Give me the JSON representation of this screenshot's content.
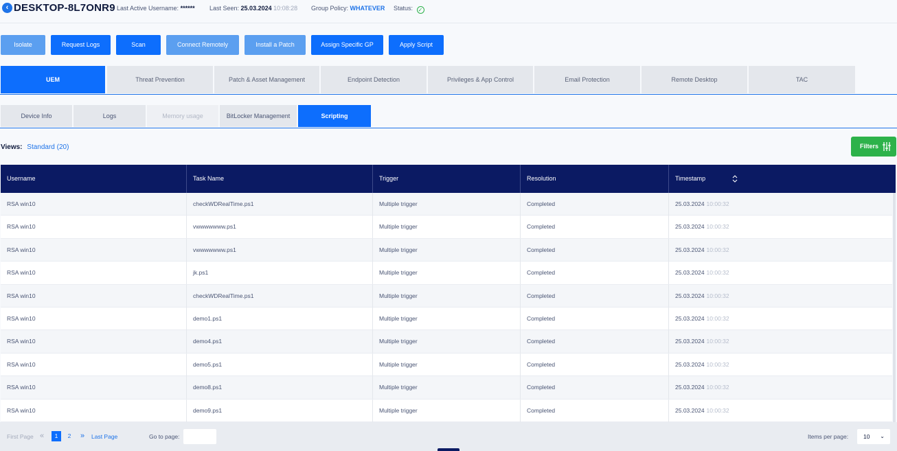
{
  "header": {
    "hostname": "DESKTOP-8L7ONR9",
    "last_active_label": "Last Active Username:",
    "last_active_value": "******",
    "last_seen_label": "Last Seen:",
    "last_seen_date": "25.03.2024",
    "last_seen_time": "10:08:28",
    "group_policy_label": "Group Policy:",
    "group_policy_value": "WHATEVER",
    "status_label": "Status:",
    "status_icon": "check-circle-icon"
  },
  "actions": [
    {
      "label": "Isolate"
    },
    {
      "label": "Request Logs"
    },
    {
      "label": "Scan"
    },
    {
      "label": "Connect Remotely"
    },
    {
      "label": "Install a Patch"
    },
    {
      "label": "Assign Specific GP"
    },
    {
      "label": "Apply Script"
    }
  ],
  "main_tabs": [
    {
      "label": "UEM"
    },
    {
      "label": "Threat Prevention"
    },
    {
      "label": "Patch & Asset Management"
    },
    {
      "label": "Endpoint Detection"
    },
    {
      "label": "Privileges & App Control"
    },
    {
      "label": "Email Protection"
    },
    {
      "label": "Remote Desktop"
    },
    {
      "label": "TAC"
    }
  ],
  "sub_tabs": [
    {
      "label": "Device Info"
    },
    {
      "label": "Logs"
    },
    {
      "label": "Memory usage"
    },
    {
      "label": "BitLocker Management"
    },
    {
      "label": "Scripting"
    }
  ],
  "views": {
    "label": "Views:",
    "value": "Standard (20)"
  },
  "filters": {
    "label": "Filters",
    "icon": "sliders-icon",
    "color": "#2db24a"
  },
  "table": {
    "columns": [
      "Username",
      "Task Name",
      "Trigger",
      "Resolution",
      "Timestamp"
    ],
    "rows": [
      {
        "username": "RSA win10",
        "task": "checkWDRealTime.ps1",
        "trigger": "Multiple trigger",
        "resolution": "Completed",
        "date": "25.03.2024",
        "time": "10:00:32"
      },
      {
        "username": "RSA win10",
        "task": "vwwwwwww.ps1",
        "trigger": "Multiple trigger",
        "resolution": "Completed",
        "date": "25.03.2024",
        "time": "10:00:32"
      },
      {
        "username": "RSA win10",
        "task": "vwwwwwww.ps1",
        "trigger": "Multiple trigger",
        "resolution": "Completed",
        "date": "25.03.2024",
        "time": "10:00:32"
      },
      {
        "username": "RSA win10",
        "task": "jk.ps1",
        "trigger": "Multiple trigger",
        "resolution": "Completed",
        "date": "25.03.2024",
        "time": "10:00:32"
      },
      {
        "username": "RSA win10",
        "task": "checkWDRealTime.ps1",
        "trigger": "Multiple trigger",
        "resolution": "Completed",
        "date": "25.03.2024",
        "time": "10:00:32"
      },
      {
        "username": "RSA win10",
        "task": "demo1.ps1",
        "trigger": "Multiple trigger",
        "resolution": "Completed",
        "date": "25.03.2024",
        "time": "10:00:32"
      },
      {
        "username": "RSA win10",
        "task": "demo4.ps1",
        "trigger": "Multiple trigger",
        "resolution": "Completed",
        "date": "25.03.2024",
        "time": "10:00:32"
      },
      {
        "username": "RSA win10",
        "task": "demo5.ps1",
        "trigger": "Multiple trigger",
        "resolution": "Completed",
        "date": "25.03.2024",
        "time": "10:00:32"
      },
      {
        "username": "RSA win10",
        "task": "demo8.ps1",
        "trigger": "Multiple trigger",
        "resolution": "Completed",
        "date": "25.03.2024",
        "time": "10:00:32"
      },
      {
        "username": "RSA win10",
        "task": "demo9.ps1",
        "trigger": "Multiple trigger",
        "resolution": "Completed",
        "date": "25.03.2024",
        "time": "10:00:32"
      }
    ]
  },
  "pagination": {
    "first_label": "First Page",
    "prev_icon": "double-chevron-left-icon",
    "pages": [
      "1",
      "2"
    ],
    "current_page": "1",
    "next_icon": "double-chevron-right-icon",
    "last_label": "Last Page",
    "goto_label": "Go to page:",
    "goto_value": "",
    "items_per_page_label": "Items per page:",
    "items_per_page_value": "10"
  }
}
